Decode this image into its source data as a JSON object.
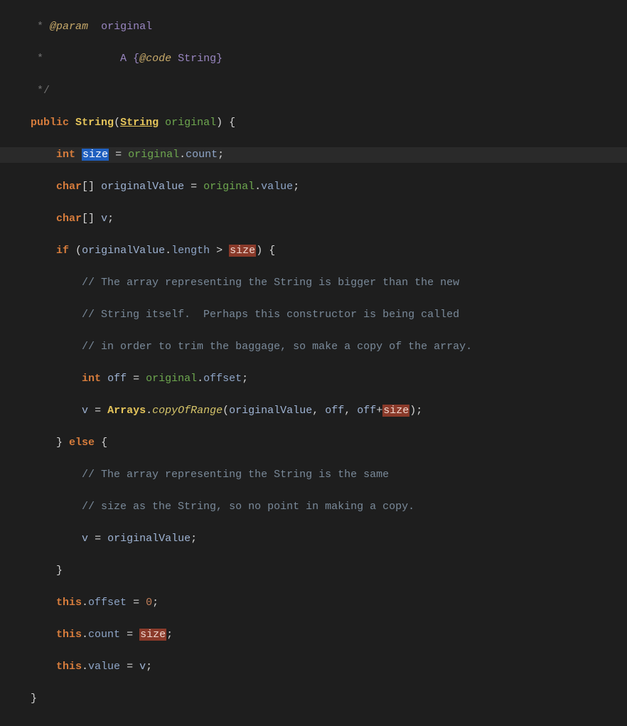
{
  "doc": {
    "param_tag": "@param",
    "param_name": "original",
    "desc_a": "A {",
    "desc_code": "@code",
    "desc_string": " String",
    "desc_close": "}"
  },
  "tokens": {
    "public": "public",
    "int": "int",
    "char_arr": "char",
    "if": "if",
    "else": "else",
    "this": "this",
    "String": "String",
    "Arrays": "Arrays",
    "copyOfRange": "copyOfRange"
  },
  "vars": {
    "size": "size",
    "original": "original",
    "originalValue": "originalValue",
    "v": "v",
    "off": "off"
  },
  "fields": {
    "count": "count",
    "value": "value",
    "length": "length",
    "offset": "offset"
  },
  "comments": {
    "c1": "// The array representing the String is bigger than the new",
    "c2": "// String itself.  Perhaps this constructor is being called",
    "c3": "// in order to trim the baggage, so make a copy of the array.",
    "c4": "// The array representing the String is the same",
    "c5": "// size as the String, so no point in making a copy."
  },
  "nums": {
    "zero": "0"
  },
  "editor": {
    "selected_word": "size"
  }
}
